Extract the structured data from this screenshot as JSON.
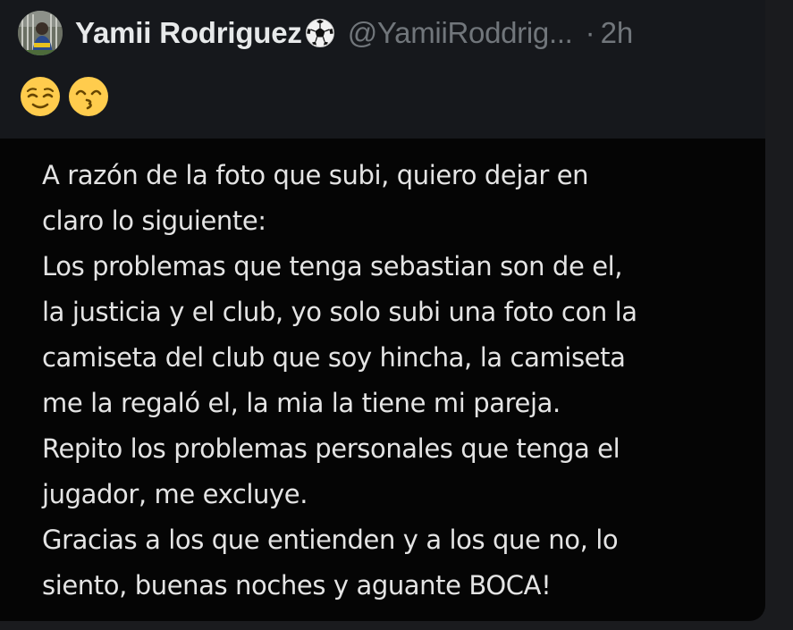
{
  "tweet": {
    "display_name": "Yamii Rodriguez",
    "handle": "@YamiiRoddrig...",
    "separator": "·",
    "time": "2h",
    "name_icon": "soccer-ball-icon",
    "avatar_icon": "avatar-photo",
    "emojis": [
      "relieved-face-emoji",
      "kissing-face-smiling-eyes-emoji"
    ],
    "text_lines": [
      "A razón de la foto que subi, quiero dejar en",
      "claro lo siguiente:",
      "Los problemas que tenga sebastian son de el,",
      "la justicia y el club, yo solo subi una foto con la",
      "camiseta del club que soy hincha, la camiseta",
      "me la regaló el, la mia la tiene mi pareja.",
      "Repito los problemas personales que tenga el",
      "jugador, me excluye.",
      "Gracias a los que entienden y a los que no, lo",
      "siento, buenas noches y aguante BOCA!"
    ]
  },
  "colors": {
    "page_background": "#1a1b1e",
    "header_background": "#16181c",
    "body_background": "#050505",
    "name_color": "#e7e9ea",
    "muted_color": "#71767b",
    "text_color": "#e4e4e4",
    "emoji_yellow": "#ffcc4d"
  }
}
